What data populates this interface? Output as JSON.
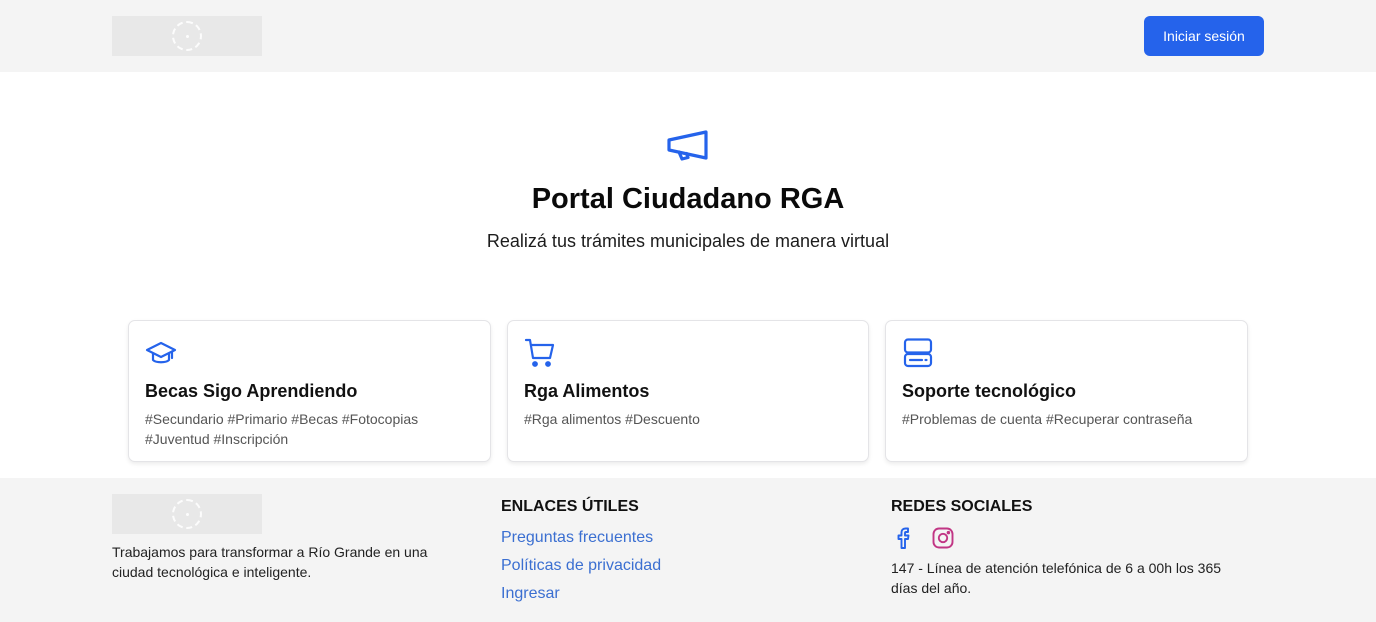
{
  "header": {
    "logo_icon": "municipal-seal-icon",
    "login_label": "Iniciar sesión",
    "accent_color": "#2563eb"
  },
  "hero": {
    "icon": "megaphone-icon",
    "title": "Portal Ciudadano RGA",
    "subtitle": "Realizá tus trámites municipales de manera virtual"
  },
  "cards": [
    {
      "icon": "graduation-cap-icon",
      "title": "Becas Sigo Aprendiendo",
      "tags": "#Secundario #Primario #Becas #Fotocopias #Juventud #Inscripción"
    },
    {
      "icon": "shopping-cart-icon",
      "title": "Rga Alimentos",
      "tags": "#Rga alimentos #Descuento"
    },
    {
      "icon": "server-icon",
      "title": "Soporte tecnológico",
      "tags": "#Problemas de cuenta #Recuperar contraseña"
    }
  ],
  "footer": {
    "logo_icon": "municipal-seal-icon",
    "about": "Trabajamos para transformar a Río Grande en una ciudad tecnológica e inteligente.",
    "links_heading": "ENLACES ÚTILES",
    "links": [
      "Preguntas frecuentes",
      "Políticas de privacidad",
      "Ingresar"
    ],
    "social_heading": "REDES SOCIALES",
    "social_icons": [
      "facebook-icon",
      "instagram-icon"
    ],
    "contact": "147 - Línea de atención telefónica de 6 a 00h los 365 días del año.",
    "link_color": "#3b6fd1",
    "instagram_color": "#c13584"
  }
}
